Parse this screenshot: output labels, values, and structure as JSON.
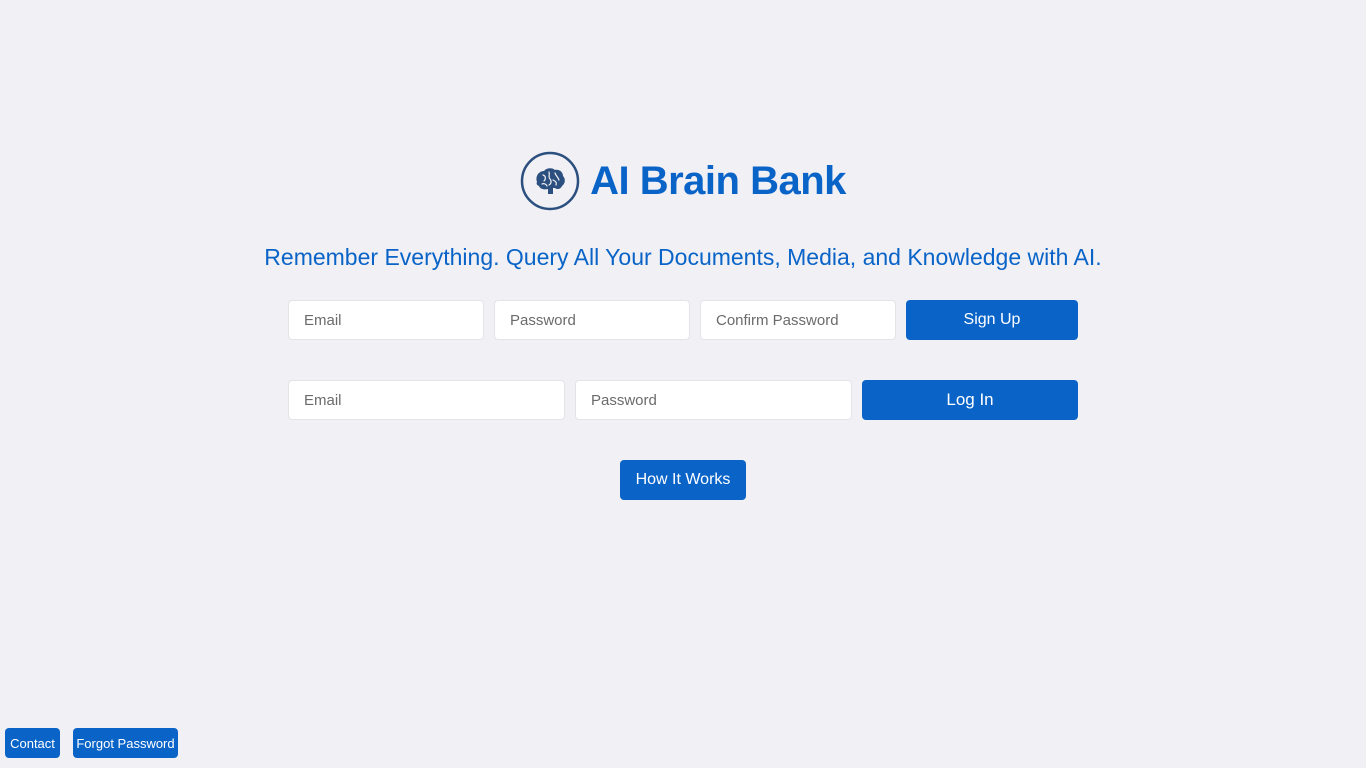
{
  "brand": {
    "title": "AI Brain Bank",
    "logo_icon": "brain-icon",
    "accent_color": "#0a64c8",
    "logo_stroke_color": "#2b4f7e"
  },
  "tagline": "Remember Everything. Query All Your Documents, Media, and Knowledge with AI.",
  "signup": {
    "email_placeholder": "Email",
    "password_placeholder": "Password",
    "confirm_placeholder": "Confirm Password",
    "button_label": "Sign Up"
  },
  "login": {
    "email_placeholder": "Email",
    "password_placeholder": "Password",
    "button_label": "Log In"
  },
  "how_it_works_label": "How It Works",
  "footer": {
    "contact_label": "Contact",
    "forgot_label": "Forgot Password"
  }
}
